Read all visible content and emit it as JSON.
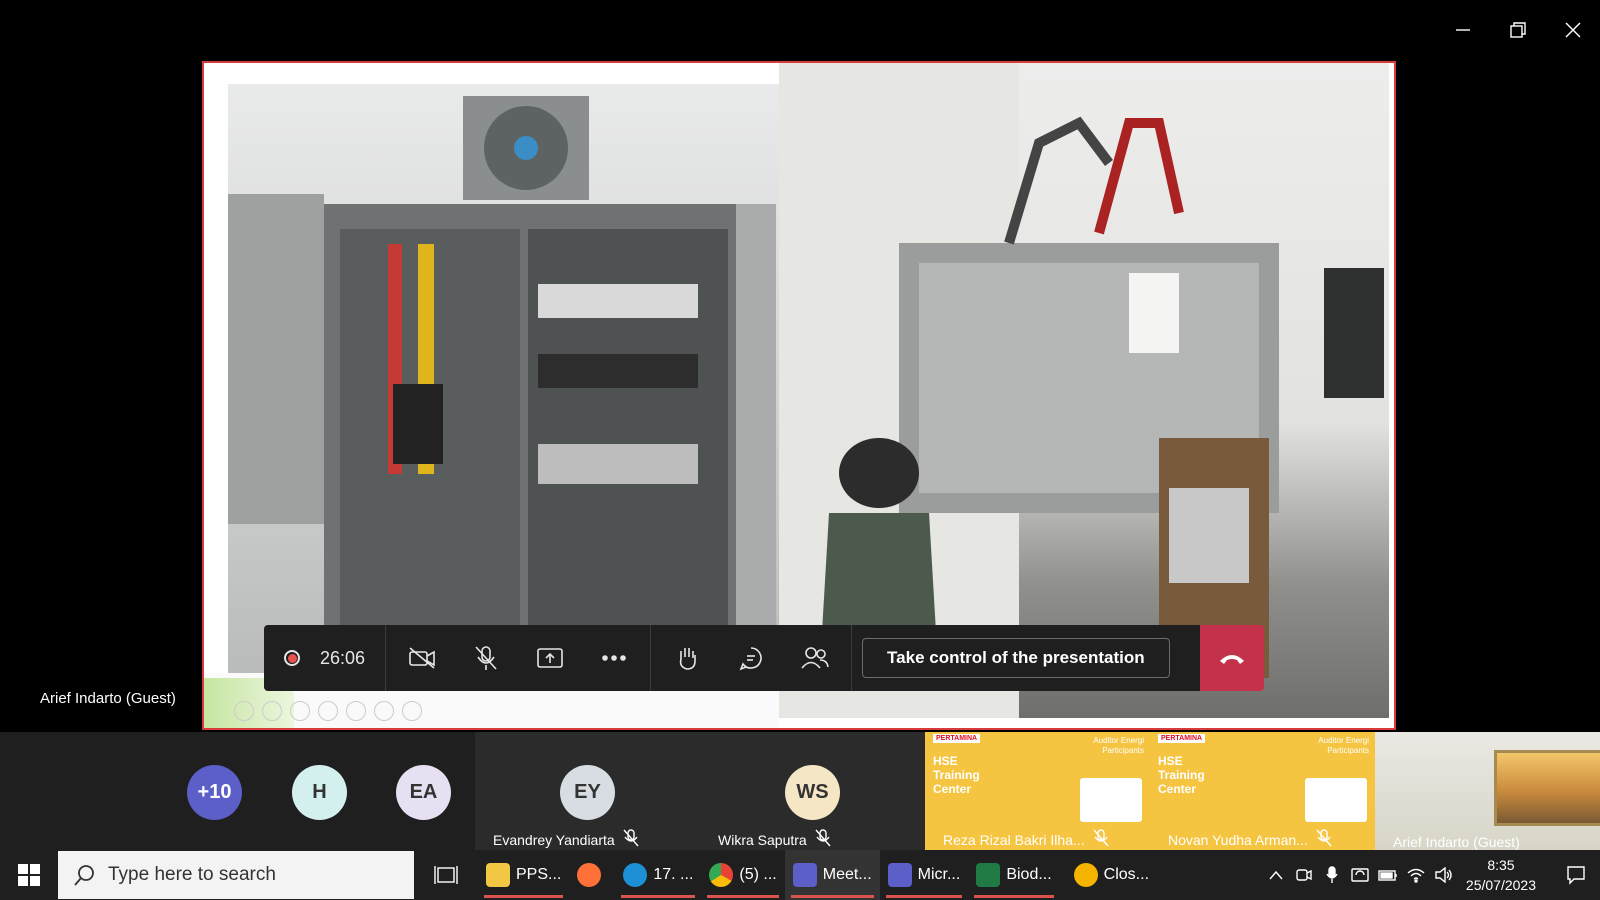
{
  "window": {
    "controls": [
      "minimize-icon",
      "restore-icon",
      "close-icon"
    ]
  },
  "presenter": {
    "name": "Arief Indarto (Guest)"
  },
  "meeting_bar": {
    "timer": "26:06",
    "take_control_label": "Take control of the presentation",
    "hangup_color": "#c4314b"
  },
  "participants": {
    "overflow_badge": "+10",
    "avatars": [
      {
        "initials": "H",
        "color": "#d4f0ee"
      },
      {
        "initials": "EA",
        "color": "#e7e0f2"
      }
    ],
    "tiles": [
      {
        "initials": "EY",
        "name": "Evandrey Yandiarta",
        "color": "#d7dde3"
      },
      {
        "initials": "WS",
        "name": "Wikra Saputra",
        "color": "#f5e6c6"
      }
    ],
    "video_tiles": [
      {
        "logo": "PERTAMINA",
        "title": "HSE Training Center",
        "subtitle": "Auditor Energi Participants",
        "name": "Reza Rizal Bakri Ilha..."
      },
      {
        "logo": "PERTAMINA",
        "title": "HSE Training Center",
        "subtitle": "Auditor Energi Participants",
        "name": "Novan Yudha Arman..."
      }
    ],
    "camera_tile": {
      "name": "Arief Indarto (Guest)"
    }
  },
  "taskbar": {
    "search_placeholder": "Type here to search",
    "apps": [
      {
        "label": "PPS...",
        "icon": "folder-icon",
        "color": "#f2c744"
      },
      {
        "label": "",
        "icon": "firefox-icon",
        "color": "#ff7139"
      },
      {
        "label": "17. ...",
        "icon": "edge-icon",
        "color": "#1e90d6"
      },
      {
        "label": "(5) ...",
        "icon": "chrome-icon",
        "color": "#34a853"
      },
      {
        "label": "Meet...",
        "icon": "teams-icon",
        "color": "#5b5fc7"
      },
      {
        "label": "Micr...",
        "icon": "teams-icon",
        "color": "#5b5fc7"
      },
      {
        "label": "Biod...",
        "icon": "excel-icon",
        "color": "#1f7a44"
      },
      {
        "label": "Clos...",
        "icon": "app-icon",
        "color": "#f5b400"
      }
    ],
    "clock": {
      "time": "8:35",
      "date": "25/07/2023"
    }
  }
}
